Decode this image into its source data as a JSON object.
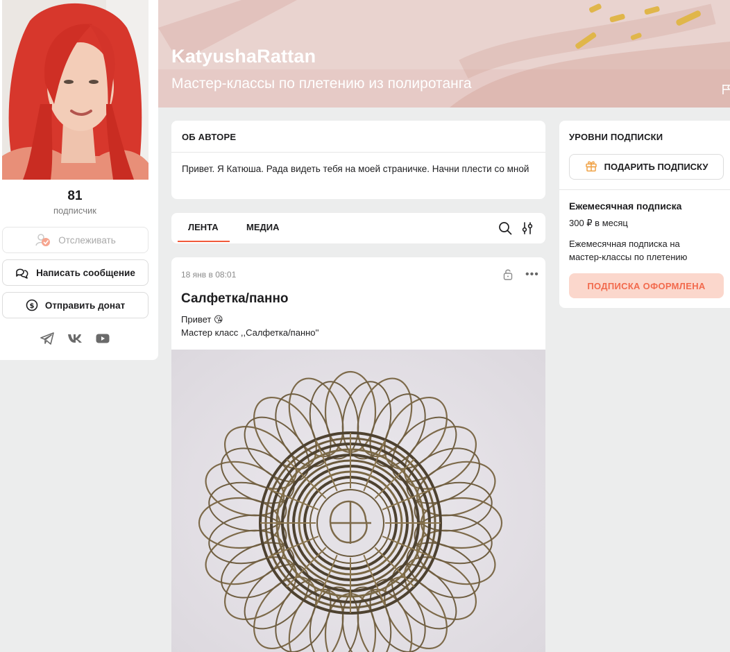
{
  "profile": {
    "subscribers_count": "81",
    "subscribers_label": "подписчик",
    "follow_label": "Отслеживать",
    "message_label": "Написать сообщение",
    "donate_label": "Отправить донат",
    "socials": [
      "telegram-icon",
      "vk-icon",
      "youtube-icon"
    ]
  },
  "banner": {
    "title": "KatyushaRattan",
    "subtitle": "Мастер-классы по плетению из полиротанга"
  },
  "about": {
    "heading": "ОБ АВТОРЕ",
    "text": "Привет. Я Катюша. Рада видеть тебя на моей страничке. Начни плести со мной"
  },
  "tabs": {
    "feed": "ЛЕНТА",
    "media": "МЕДИА"
  },
  "post": {
    "date": "18 янв в 08:01",
    "title": "Салфетка/панно",
    "line1": "Привет 😘",
    "line2": "Мастер класс ,,Салфетка/панно''"
  },
  "tiers": {
    "heading": "УРОВНИ ПОДПИСКИ",
    "gift_label": "ПОДАРИТЬ ПОДПИСКУ",
    "tier_name": "Ежемесячная подписка",
    "tier_price": "300 ₽ в месяц",
    "tier_desc": "Ежемесячная подписка на мастер-классы по плетению",
    "tier_button": "ПОДПИСКА ОФОРМЛЕНА"
  },
  "colors": {
    "accent": "#f15a3a",
    "accent_soft": "#fbd7cc",
    "banner": "#e9d0cb",
    "page_bg": "#eceded"
  }
}
